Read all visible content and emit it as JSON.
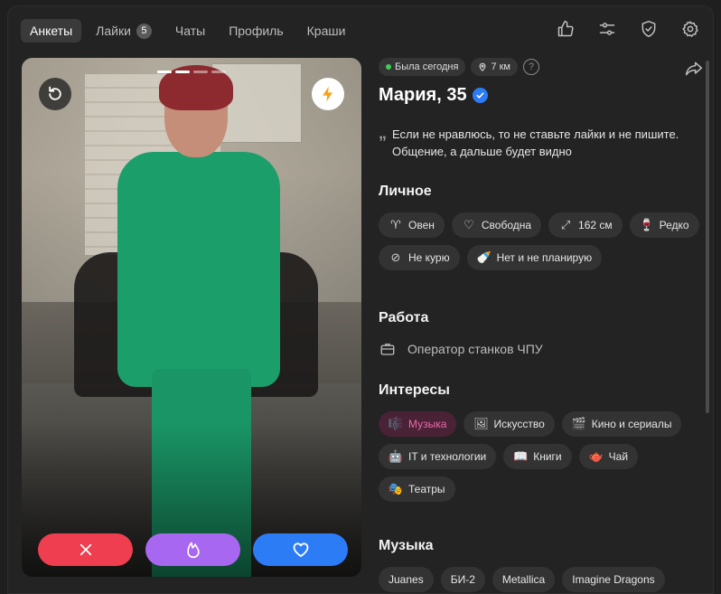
{
  "nav": {
    "tabs": [
      {
        "label": "Анкеты",
        "active": true
      },
      {
        "label": "Лайки",
        "badge": "5"
      },
      {
        "label": "Чаты"
      },
      {
        "label": "Профиль"
      },
      {
        "label": "Краши"
      }
    ],
    "right_icons": [
      "thumbs-up-icon",
      "filter-sliders-icon",
      "shield-check-icon",
      "gear-icon"
    ]
  },
  "photo": {
    "dots_total": 4,
    "dots_active": 2,
    "buttons": {
      "undo": "undo-icon",
      "boost": "lightning-icon"
    },
    "actions": [
      {
        "name": "dislike",
        "icon": "close-icon",
        "color": "#ef3e50"
      },
      {
        "name": "superlike",
        "icon": "flame-icon",
        "color": "#a867f0"
      },
      {
        "name": "like",
        "icon": "heart-icon",
        "color": "#2c7cf6"
      }
    ]
  },
  "profile": {
    "status": "Была сегодня",
    "distance": "7 км",
    "name": "Мария, 35",
    "verified": true,
    "quote": "Если не нравлюсь, то не ставьте лайки и не пишите. Общение, а дальше будет видно"
  },
  "personal": {
    "title": "Личное",
    "chips": [
      {
        "icon": "aries-icon",
        "glyph": "♈",
        "label": "Овен"
      },
      {
        "icon": "heart-outline-icon",
        "glyph": "♡",
        "label": "Свободна"
      },
      {
        "icon": "height-icon",
        "glyph": "⤢",
        "label": "162 см"
      },
      {
        "icon": "wine-glass-icon",
        "glyph": "🍷",
        "label": "Редко"
      },
      {
        "icon": "cigarette-icon",
        "glyph": "⊘",
        "label": "Не курю"
      },
      {
        "icon": "baby-bottle-icon",
        "glyph": "🍼",
        "label": "Нет и не планирую"
      }
    ]
  },
  "work": {
    "title": "Работа",
    "job": "Оператор станков ЧПУ"
  },
  "interests": {
    "title": "Интересы",
    "chips": [
      {
        "glyph": "🎼",
        "label": "Музыка",
        "highlight": true
      },
      {
        "glyph": "🖼",
        "label": "Искусство"
      },
      {
        "glyph": "🎬",
        "label": "Кино и сериалы"
      },
      {
        "glyph": "🤖",
        "label": "IT и технологии"
      },
      {
        "glyph": "📖",
        "label": "Книги"
      },
      {
        "glyph": "🫖",
        "label": "Чай"
      },
      {
        "glyph": "🎭",
        "label": "Театры"
      }
    ]
  },
  "music": {
    "title": "Музыка",
    "chips": [
      "Juanes",
      "БИ-2",
      "Metallica",
      "Imagine Dragons"
    ]
  }
}
